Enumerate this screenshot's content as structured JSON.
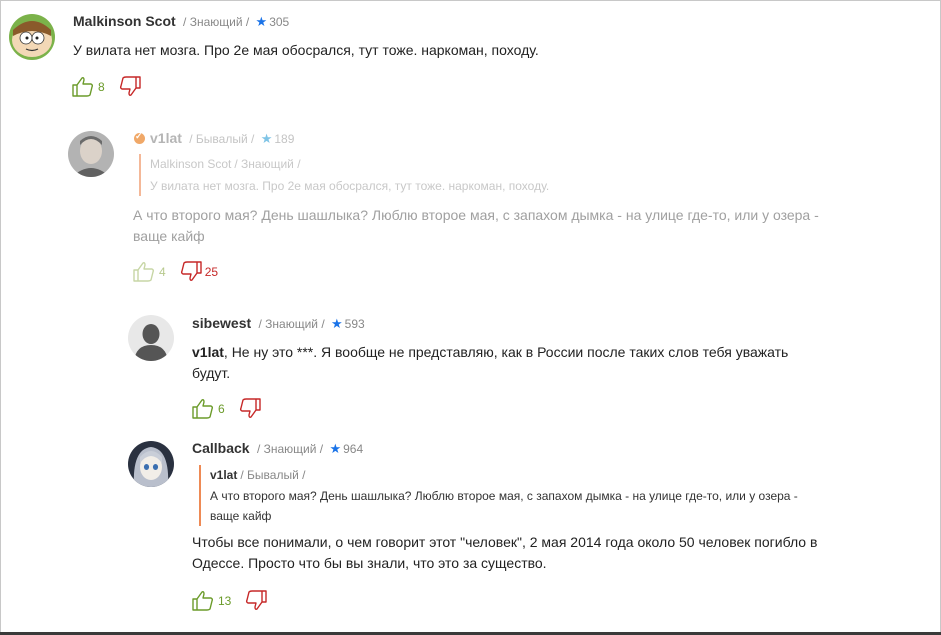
{
  "comments": [
    {
      "username": "Malkinson Scot",
      "rank": "/ Знающий /",
      "rating": "305",
      "text": "У вилата нет мозга. Про 2е мая обосрался, тут тоже. наркоман, походу.",
      "likes": "8",
      "dislikes": ""
    },
    {
      "username": "v1lat",
      "rank": "/ Бывалый /",
      "rating": "189",
      "quote": {
        "username": "Malkinson Scot",
        "rank": "/ Знающий /",
        "text": "У вилата нет мозга. Про 2е мая обосрался, тут тоже. наркоман, походу."
      },
      "text": "А что второго мая? День шашлыка? Люблю второе мая, с запахом дымка - на улице где-то, или у озера - ваще кайф",
      "likes": "4",
      "dislikes": "25"
    },
    {
      "username": "sibewest",
      "rank": "/ Знающий /",
      "rating": "593",
      "mention": "v1lat",
      "text": ", Не ну это ***. Я вообще не представляю, как в России после таких слов тебя уважать будут.",
      "likes": "6",
      "dislikes": ""
    },
    {
      "username": "Callback",
      "rank": "/ Знающий /",
      "rating": "964",
      "quote": {
        "username": "v1lat",
        "rank": "/ Бывалый /",
        "text": "А что второго мая? День шашлыка? Люблю второе мая, с запахом дымка - на улице где-то, или у озера - ваще кайф"
      },
      "text": "Чтобы все понимали, о чем говорит этот \"человек\", 2 мая 2014 года около 50 человек погибло в Одессе. Просто что бы вы знали, что это за существо.",
      "likes": "13",
      "dislikes": ""
    }
  ],
  "colors": {
    "like": "#6b9b2a",
    "dislike": "#c62828",
    "star": "#1a73e8",
    "quote_border": "#ee8a55"
  }
}
